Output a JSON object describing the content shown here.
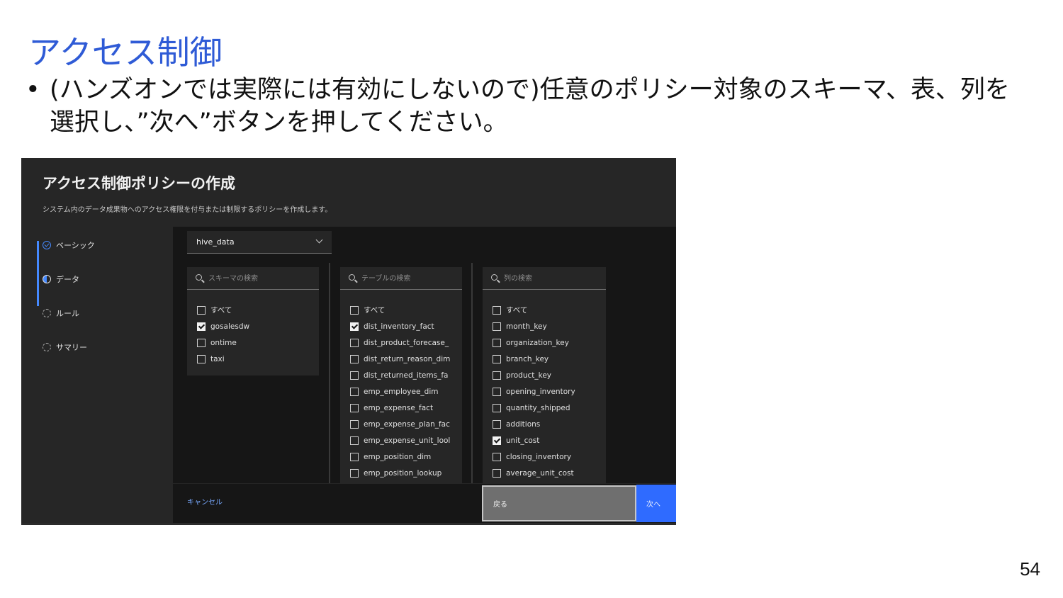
{
  "slide": {
    "title": "アクセス制御",
    "bullet_mark": "•",
    "bullet_text": "(ハンズオンでは実際には有効にしないので)任意のポリシー対象のスキーマ、表、列を選択し、”次へ”ボタンを押してください。",
    "page_number": "54"
  },
  "screenshot": {
    "title": "アクセス制御ポリシーの作成",
    "description": "システム内のデータ成果物へのアクセス権限を付与または制限するポリシーを作成します。",
    "steps": [
      {
        "label": "ベーシック",
        "icon": "check-circle-icon"
      },
      {
        "label": "データ",
        "icon": "half-circle-icon"
      },
      {
        "label": "ルール",
        "icon": "dashed-circle-icon"
      },
      {
        "label": "サマリー",
        "icon": "dashed-circle-icon"
      }
    ],
    "catalog_dropdown": {
      "value": "hive_data"
    },
    "schema_column": {
      "placeholder": "スキーマの検索",
      "items": [
        {
          "label": "すべて",
          "checked": false
        },
        {
          "label": "gosalesdw",
          "checked": true
        },
        {
          "label": "ontime",
          "checked": false
        },
        {
          "label": "taxi",
          "checked": false
        }
      ]
    },
    "table_column": {
      "placeholder": "テーブルの検索",
      "items": [
        {
          "label": "すべて",
          "checked": false
        },
        {
          "label": "dist_inventory_fact",
          "checked": true
        },
        {
          "label": "dist_product_forecase_",
          "checked": false
        },
        {
          "label": "dist_return_reason_dim",
          "checked": false
        },
        {
          "label": "dist_returned_items_fa",
          "checked": false
        },
        {
          "label": "emp_employee_dim",
          "checked": false
        },
        {
          "label": "emp_expense_fact",
          "checked": false
        },
        {
          "label": "emp_expense_plan_fac",
          "checked": false
        },
        {
          "label": "emp_expense_unit_lool",
          "checked": false
        },
        {
          "label": "emp_position_dim",
          "checked": false
        },
        {
          "label": "emp_position_lookup",
          "checked": false
        }
      ]
    },
    "column_column": {
      "placeholder": "列の検索",
      "items": [
        {
          "label": "すべて",
          "checked": false
        },
        {
          "label": "month_key",
          "checked": false
        },
        {
          "label": "organization_key",
          "checked": false
        },
        {
          "label": "branch_key",
          "checked": false
        },
        {
          "label": "product_key",
          "checked": false
        },
        {
          "label": "opening_inventory",
          "checked": false
        },
        {
          "label": "quantity_shipped",
          "checked": false
        },
        {
          "label": "additions",
          "checked": false
        },
        {
          "label": "unit_cost",
          "checked": true
        },
        {
          "label": "closing_inventory",
          "checked": false
        },
        {
          "label": "average_unit_cost",
          "checked": false
        }
      ]
    },
    "footer": {
      "cancel_label": "キャンセル",
      "back_label": "戻る",
      "next_label": "次へ"
    }
  }
}
